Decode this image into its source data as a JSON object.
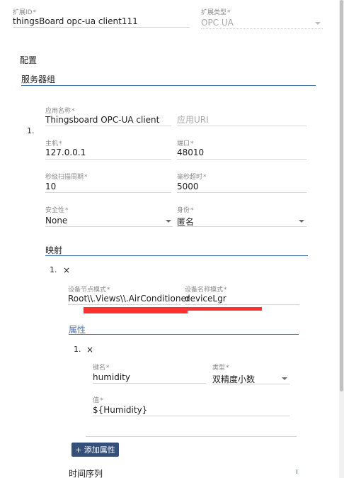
{
  "extension": {
    "id_label": "扩展ID",
    "id_value": "thingsBoard opc-ua client111",
    "type_label": "扩展类型",
    "type_value": "OPC UA"
  },
  "config": {
    "title": "配置",
    "server_group": {
      "title": "服务器组",
      "index": "1.",
      "app_name_label": "应用名称",
      "app_name_value": "Thingsboard OPC-UA client",
      "app_uri_placeholder": "应用URI",
      "host_label": "主机",
      "host_value": "127.0.0.1",
      "port_label": "端口",
      "port_value": "48010",
      "scan_period_label": "秒级扫描周期",
      "scan_period_value": "10",
      "timeout_label": "毫秒超时",
      "timeout_value": "5000",
      "security_label": "安全性",
      "security_value": "None",
      "identity_label": "身份",
      "identity_value": "匿名"
    },
    "mapping": {
      "title": "映射",
      "index": "1.",
      "close_glyph": "×",
      "node_pattern_label": "设备节点模式",
      "node_pattern_value": "Root\\\\.Views\\\\.AirConditioner",
      "device_name_label": "设备名称模式",
      "device_name_value": "deviceLgr",
      "attributes": {
        "title": "属性",
        "index": "1.",
        "close_glyph": "×",
        "key_label": "键名",
        "key_value": "humidity",
        "type_label": "类型",
        "type_value": "双精度小数",
        "value_label": "值",
        "value_value": "${Humidity}",
        "add_button": "+ 添加属性"
      },
      "timeseries_title": "时间序列"
    }
  },
  "colors": {
    "accent": "#3f6fb5",
    "button": "#34507a",
    "redaction": "#ff3030"
  }
}
